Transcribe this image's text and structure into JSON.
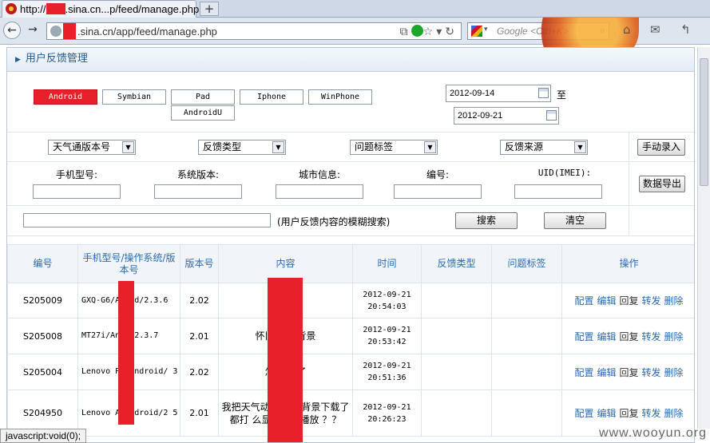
{
  "browser": {
    "tab_title_prefix": "http://",
    "tab_title_suffix": ".sina.cn...p/feed/manage.php",
    "newtab_label": "+",
    "url_text": ".sina.cn/app/feed/manage.php",
    "search_placeholder": "Google <Ctrl+K>",
    "status_text": "javascript:void(0);"
  },
  "page": {
    "section_title": "用户反馈管理",
    "platforms": [
      {
        "label": "Android",
        "active": true
      },
      {
        "label": "Symbian",
        "active": false
      },
      {
        "label": "Pad",
        "active": false
      },
      {
        "label": "Iphone",
        "active": false
      },
      {
        "label": "WinPhone",
        "active": false
      },
      {
        "label": "AndroidU",
        "active": false
      }
    ],
    "date_from": "2012-09-14",
    "date_to_label": "至",
    "date_to": "2012-09-21",
    "selects": [
      "天气通版本号",
      "反馈类型",
      "问题标签",
      "反馈来源"
    ],
    "manual_entry_button": "手动录入",
    "export_button": "数据导出",
    "field_labels": [
      "手机型号:",
      "系统版本:",
      "城市信息:",
      "编号:",
      "UID(IMEI):"
    ],
    "fuzzy_search_hint": "(用户反馈内容的模糊搜索)",
    "search_button": "搜索",
    "clear_button": "清空",
    "table": {
      "headers": [
        "编号",
        "手机型号/操作系统/版本号",
        "版本号",
        "内容",
        "时间",
        "反馈类型",
        "问题标签",
        "操作"
      ],
      "ops": [
        "配置",
        "编辑",
        "回复",
        "转发",
        "删除"
      ],
      "rows": [
        {
          "id": "S205009",
          "model": "GXQ-G6/A     oid/2.3.6",
          "ver": "2.02",
          "content": "没          纸",
          "time": "2012-09-21 20:54:03"
        },
        {
          "id": "S205008",
          "model": "MT27i/An     d/2.3.7",
          "ver": "2.01",
          "content": "怀旧的       加背景",
          "time": "2012-09-21 20:53:42"
        },
        {
          "id": "S205004",
          "model": "Lenovo P     /Android/      3",
          "ver": "2.02",
          "content": "怎么        出了",
          "time": "2012-09-21 20:51:36"
        },
        {
          "id": "S204950",
          "model": "Lenovo A     Android/2      5",
          "ver": "2.01",
          "content": "我把天气动      换天气背景下载了都打       么显示无法播放       ？？",
          "time": "2012-09-21 20:26:23"
        }
      ]
    }
  },
  "watermark": "www.wooyun.org"
}
